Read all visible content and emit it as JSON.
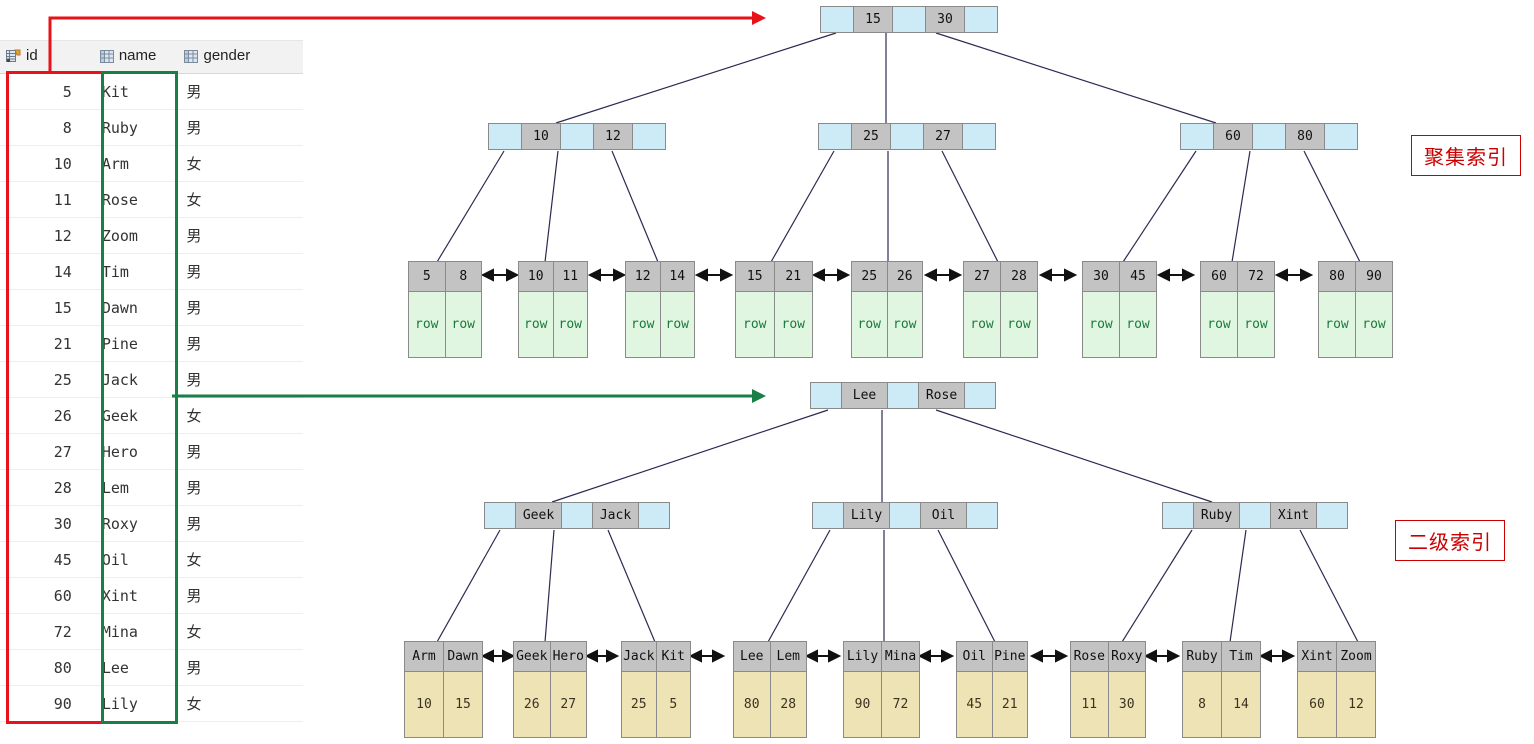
{
  "table": {
    "columns": [
      {
        "label": "id",
        "icon": "primary-key-column-icon"
      },
      {
        "label": "name",
        "icon": "column-icon"
      },
      {
        "label": "gender",
        "icon": "column-icon"
      }
    ],
    "rows": [
      {
        "id": "5",
        "name": "Kit",
        "gender": "男"
      },
      {
        "id": "8",
        "name": "Ruby",
        "gender": "男"
      },
      {
        "id": "10",
        "name": "Arm",
        "gender": "女"
      },
      {
        "id": "11",
        "name": "Rose",
        "gender": "女"
      },
      {
        "id": "12",
        "name": "Zoom",
        "gender": "男"
      },
      {
        "id": "14",
        "name": "Tim",
        "gender": "男"
      },
      {
        "id": "15",
        "name": "Dawn",
        "gender": "男"
      },
      {
        "id": "21",
        "name": "Pine",
        "gender": "男"
      },
      {
        "id": "25",
        "name": "Jack",
        "gender": "男"
      },
      {
        "id": "26",
        "name": "Geek",
        "gender": "女"
      },
      {
        "id": "27",
        "name": "Hero",
        "gender": "男"
      },
      {
        "id": "28",
        "name": "Lem",
        "gender": "男"
      },
      {
        "id": "30",
        "name": "Roxy",
        "gender": "男"
      },
      {
        "id": "45",
        "name": "Oil",
        "gender": "女"
      },
      {
        "id": "60",
        "name": "Xint",
        "gender": "男"
      },
      {
        "id": "72",
        "name": "Mina",
        "gender": "女"
      },
      {
        "id": "80",
        "name": "Lee",
        "gender": "男"
      },
      {
        "id": "90",
        "name": "Lily",
        "gender": "女"
      }
    ],
    "highlight": {
      "id_column_color": "#e8131a",
      "name_column_color": "#1a7f47"
    }
  },
  "captions": {
    "clustered": "聚集索引",
    "secondary": "二级索引",
    "color": "#cc0000"
  },
  "clustered_index": {
    "root": {
      "keys": [
        "15",
        "30"
      ]
    },
    "level2": [
      {
        "keys": [
          "10",
          "12"
        ]
      },
      {
        "keys": [
          "25",
          "27"
        ]
      },
      {
        "keys": [
          "60",
          "80"
        ]
      }
    ],
    "leaves": [
      {
        "keys": [
          "5",
          "8"
        ],
        "values": [
          "row",
          "row"
        ]
      },
      {
        "keys": [
          "10",
          "11"
        ],
        "values": [
          "row",
          "row"
        ]
      },
      {
        "keys": [
          "12",
          "14"
        ],
        "values": [
          "row",
          "row"
        ]
      },
      {
        "keys": [
          "15",
          "21"
        ],
        "values": [
          "row",
          "row"
        ]
      },
      {
        "keys": [
          "25",
          "26"
        ],
        "values": [
          "row",
          "row"
        ]
      },
      {
        "keys": [
          "27",
          "28"
        ],
        "values": [
          "row",
          "row"
        ]
      },
      {
        "keys": [
          "30",
          "45"
        ],
        "values": [
          "row",
          "row"
        ]
      },
      {
        "keys": [
          "60",
          "72"
        ],
        "values": [
          "row",
          "row"
        ]
      },
      {
        "keys": [
          "80",
          "90"
        ],
        "values": [
          "row",
          "row"
        ]
      }
    ]
  },
  "secondary_index": {
    "root": {
      "keys": [
        "Lee",
        "Rose"
      ]
    },
    "level2": [
      {
        "keys": [
          "Geek",
          "Jack"
        ]
      },
      {
        "keys": [
          "Lily",
          "Oil"
        ]
      },
      {
        "keys": [
          "Ruby",
          "Xint"
        ]
      }
    ],
    "leaves": [
      {
        "keys": [
          "Arm",
          "Dawn"
        ],
        "values": [
          "10",
          "15"
        ]
      },
      {
        "keys": [
          "Geek",
          "Hero"
        ],
        "values": [
          "26",
          "27"
        ]
      },
      {
        "keys": [
          "Jack",
          "Kit"
        ],
        "values": [
          "25",
          "5"
        ]
      },
      {
        "keys": [
          "Lee",
          "Lem"
        ],
        "values": [
          "80",
          "28"
        ]
      },
      {
        "keys": [
          "Lily",
          "Mina"
        ],
        "values": [
          "90",
          "72"
        ]
      },
      {
        "keys": [
          "Oil",
          "Pine"
        ],
        "values": [
          "45",
          "21"
        ]
      },
      {
        "keys": [
          "Rose",
          "Roxy"
        ],
        "values": [
          "11",
          "30"
        ]
      },
      {
        "keys": [
          "Ruby",
          "Tim"
        ],
        "values": [
          "8",
          "14"
        ]
      },
      {
        "keys": [
          "Xint",
          "Zoom"
        ],
        "values": [
          "60",
          "12"
        ]
      }
    ]
  }
}
